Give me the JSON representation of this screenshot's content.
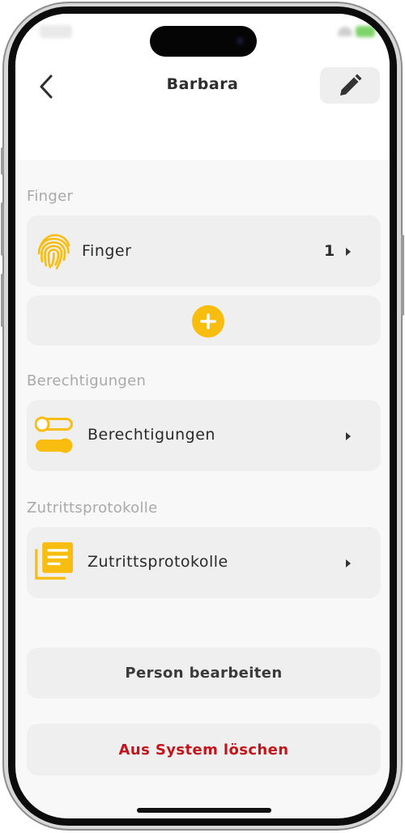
{
  "header": {
    "title": "Barbara"
  },
  "sections": {
    "finger": {
      "label": "Finger",
      "row": {
        "label": "Finger",
        "count": "1"
      }
    },
    "berechtigungen": {
      "label": "Berechtigungen",
      "row": {
        "label": "Berechtigungen"
      }
    },
    "zutritt": {
      "label": "Zutrittsprotokolle",
      "row": {
        "label": "Zutrittsprotokolle"
      }
    }
  },
  "actions": {
    "edit_person": "Person bearbeiten",
    "delete": "Aus System löschen"
  },
  "icons": {
    "back": "chevron-left-icon",
    "edit": "pencil-icon",
    "fingerprint": "fingerprint-icon",
    "add": "plus-icon",
    "permissions": "toggle-icon",
    "logs": "document-list-icon",
    "row_arrow": "caret-right-icon"
  },
  "colors": {
    "accent": "#f8bd0e",
    "danger": "#c2151b",
    "card": "#efefef",
    "background": "#f8f8f8",
    "section_label": "#a9a9a9",
    "text": "#2a2a2a"
  }
}
